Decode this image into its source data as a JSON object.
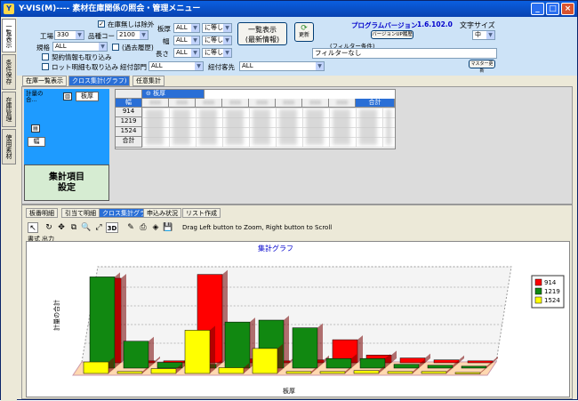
{
  "window": {
    "title": "Y-VIS(M)----  素材在庫関係の照会・管理メニュー",
    "min": "_",
    "max": "□",
    "close": "×"
  },
  "vtabs": [
    "一覧表示",
    "条件保存",
    "在庫管理",
    "使用素材"
  ],
  "header": {
    "exclude_label": "在庫無しは除外",
    "factory_label": "工場",
    "factory_value": "330",
    "product_label": "品種コード",
    "product_value": "2100",
    "spec_label": "規格",
    "spec_value": "ALL",
    "past_label": "(過去履歴)",
    "contract_label": "契約情報も取り込み",
    "lot_label": "ロット明細も取り込み",
    "thickness_label": "板厚",
    "thickness_value": "ALL",
    "thickness_op": "に等しい",
    "width_label": "幅",
    "width_value": "ALL",
    "width_op": "に等しい",
    "length_label": "長さ",
    "length_value": "ALL",
    "length_op": "に等しい",
    "dept_label": "紐付部門",
    "dept_value": "ALL",
    "customer_label": "紐付客先",
    "customer_value": "ALL",
    "list_button_line1": "一覧表示",
    "list_button_line2": "(最新情報)",
    "refresh_label": "更新",
    "version_label": "プログラムバージョン",
    "version_value": "1.6.102.0",
    "version_history_button": "バージョンUP履歴",
    "filter_caption": "(フィルター条件)",
    "filter_value": "フィルターなし",
    "font_size_label": "文字サイズ",
    "font_size_value": "中",
    "master_button": "マスター更新"
  },
  "main_tabs": [
    "在庫一覧表示",
    "クロス集計(グラフ)",
    "任意集計"
  ],
  "pivot": {
    "field_label": "計量の合... ",
    "col_field": "板厚",
    "row_field": "幅",
    "rows": [
      "914",
      "1219",
      "1524",
      "合計"
    ],
    "total_col": "合計",
    "aggregate_button_line1": "集計項目",
    "aggregate_button_line2": "設定"
  },
  "lower_tabs": [
    "板番明細",
    "引当て明細",
    "クロス集計グラフ",
    "申込み状況",
    "リスト作成"
  ],
  "toolbar": {
    "threed": "3D",
    "hint": "Drag Left button to Zoom, Right button to Scroll"
  },
  "side_tabs": [
    "書式",
    "出力"
  ],
  "chart_data": {
    "type": "bar",
    "title": "集計グラフ",
    "xlabel": "板厚",
    "ylabel": "計量の合計",
    "series": [
      {
        "name": "914",
        "color": "#ff0000",
        "values": [
          88,
          2,
          2,
          92,
          4,
          2,
          3,
          24,
          8,
          5,
          3,
          2
        ]
      },
      {
        "name": "1219",
        "color": "#118811",
        "values": [
          95,
          28,
          6,
          4,
          48,
          50,
          42,
          10,
          10,
          4,
          3,
          2
        ]
      },
      {
        "name": "1524",
        "color": "#ffff00",
        "values": [
          12,
          2,
          5,
          45,
          6,
          26,
          2,
          2,
          3,
          2,
          2,
          1
        ]
      }
    ],
    "ylim": [
      0,
      100
    ],
    "legend": "right"
  }
}
